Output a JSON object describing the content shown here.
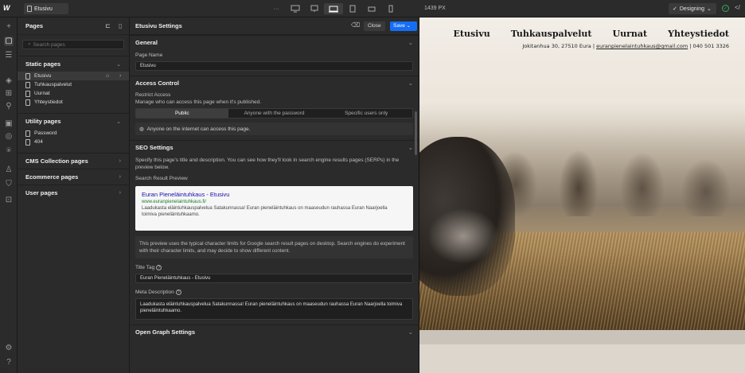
{
  "topbar": {
    "logo": "W",
    "current_page": "Etusivu",
    "canvas_width": "1439 PX",
    "mode": "Designing"
  },
  "pages_panel": {
    "title": "Pages",
    "search_placeholder": "Search pages",
    "static_section": "Static pages",
    "static_pages": [
      "Etusivu",
      "Tuhkauspalvelut",
      "Uurnat",
      "Yhteystiedot"
    ],
    "utility_section": "Utility pages",
    "utility_pages": [
      "Password",
      "404"
    ],
    "cms_section": "CMS Collection pages",
    "ecommerce_section": "Ecommerce pages",
    "user_section": "User pages"
  },
  "settings": {
    "title": "Etusivu Settings",
    "close_label": "Close",
    "save_label": "Save",
    "general": {
      "heading": "General",
      "page_name_label": "Page Name",
      "page_name_value": "Etusivu"
    },
    "access": {
      "heading": "Access Control",
      "restrict_label": "Restrict Access",
      "restrict_desc": "Manage who can access this page when it's published.",
      "options": [
        "Public",
        "Anyone with the password",
        "Specific users only"
      ],
      "selected": "Public",
      "info": "Anyone on the internet can access this page."
    },
    "seo": {
      "heading": "SEO Settings",
      "desc": "Specify this page's title and description. You can see how they'll look in search engine results pages (SERPs) in the preview below.",
      "preview_label": "Search Result Preview",
      "preview_title": "Euran Pieneläintuhkaus - Etusivu",
      "preview_url": "www.euranpienelaintuhkaus.fi/",
      "preview_desc": "Laadukasta eläintuhkauspalvelua Satakunnassa! Euran pieneläintuhkaus on maaseudun rauhassa Euran Naarjoella toimiva pieneläintuhkaamo.",
      "note": "This preview uses the typical character limits for Google search result pages on desktop. Search engines do experiment with their character limits, and may decide to show different content.",
      "title_tag_label": "Title Tag",
      "title_tag_value": "Euran Pieneläintuhkaus - Etusivu",
      "meta_label": "Meta Description",
      "meta_value": "Laadukasta eläintuhkauspalvelua Satakunnassa! Euran pieneläintuhkaus on maaseudun rauhassa Euran Naarjoella toimiva pieneläintuhkaamo."
    },
    "open_graph_heading": "Open Graph Settings"
  },
  "site": {
    "nav": [
      "Etusivu",
      "Tuhkauspalvelut",
      "Uurnat",
      "Yhteystiedot"
    ],
    "address": "Jokitanhua 30, 27510 Eura",
    "email": "euranpienelaintuhkaus@gmail.com",
    "phone": "040 501 3326"
  }
}
